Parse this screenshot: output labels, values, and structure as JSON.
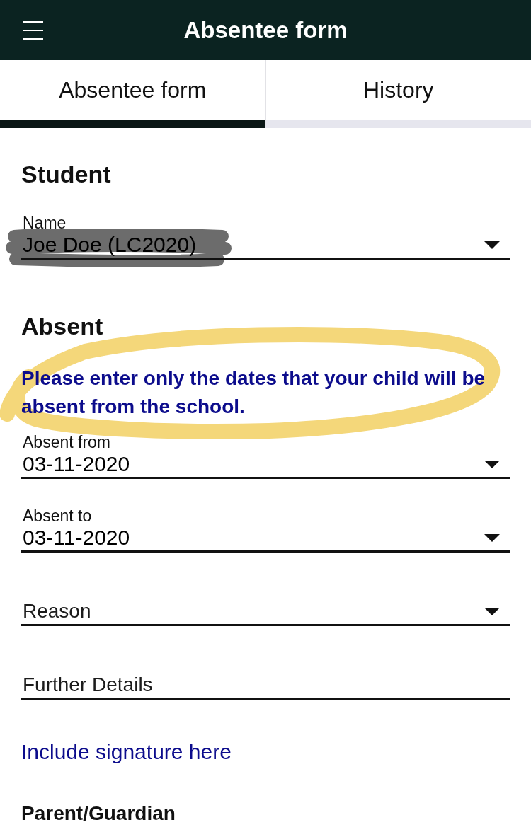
{
  "header": {
    "title": "Absentee form"
  },
  "tabs": [
    {
      "label": "Absentee form",
      "selected": true
    },
    {
      "label": "History",
      "selected": false
    }
  ],
  "sections": [
    {
      "title": "Student",
      "fields": [
        {
          "kind": "dropdown",
          "label": "Name",
          "value": "Joe Doe (LC2020)",
          "scribbled_over": true
        }
      ]
    },
    {
      "title": "Absent",
      "notice": {
        "text": "Please enter only the dates that your child will be absent from the school.",
        "circled": true
      },
      "fields": [
        {
          "kind": "dropdown",
          "label": "Absent from",
          "value": "03-11-2020",
          "scribbled_over": false
        },
        {
          "kind": "dropdown",
          "label": "Absent to",
          "value": "03-11-2020",
          "scribbled_over": false
        },
        {
          "kind": "dropdown",
          "placeholder": "Reason",
          "scribbled_over": false
        },
        {
          "kind": "text",
          "placeholder": "Further Details"
        }
      ]
    }
  ],
  "signature": {
    "link": "Include signature here",
    "title": "Parent/Guardian"
  }
}
